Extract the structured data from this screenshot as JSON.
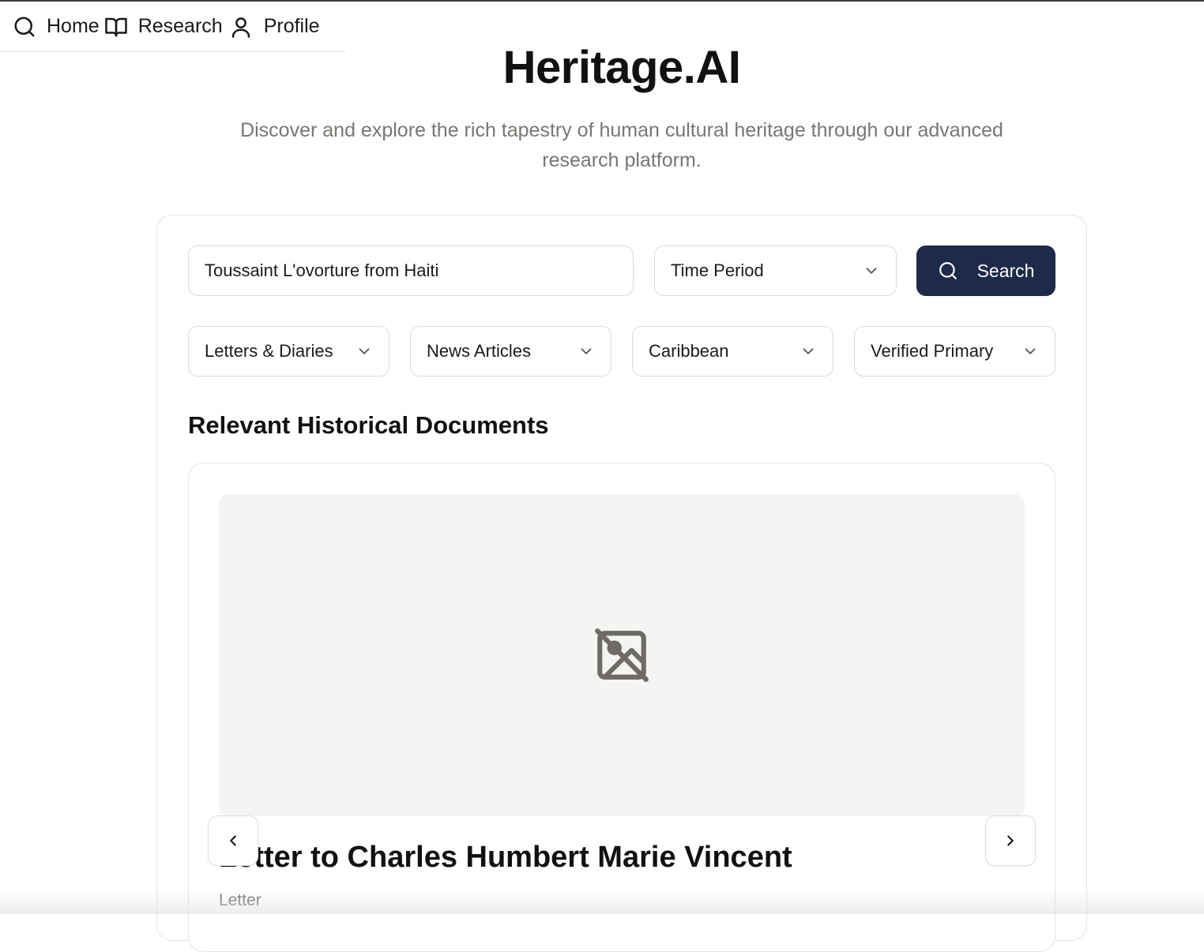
{
  "nav": {
    "items": [
      {
        "label": "Home",
        "icon": "search-icon"
      },
      {
        "label": "Research",
        "icon": "book-open-icon"
      },
      {
        "label": "Profile",
        "icon": "user-icon"
      }
    ]
  },
  "hero": {
    "title": "Heritage.AI",
    "subtitle": "Discover and explore the rich tapestry of human cultural heritage through our advanced research platform."
  },
  "search": {
    "query": "Toussaint L'ovorture from Haiti",
    "time_period": "Time Period",
    "button_label": "Search"
  },
  "filters": [
    {
      "label": "Letters & Diaries"
    },
    {
      "label": "News Articles"
    },
    {
      "label": "Caribbean"
    },
    {
      "label": "Verified Primary"
    }
  ],
  "results": {
    "section_title": "Relevant Historical Documents",
    "current": {
      "title": "Letter to Charles Humbert Marie Vincent",
      "type": "Letter",
      "image_icon": "image-off-icon"
    }
  },
  "colors": {
    "primary": "#1e2a4a",
    "muted_text": "#7a7672",
    "image_placeholder": "#f4f4f2",
    "border": "#dcdcdc"
  }
}
